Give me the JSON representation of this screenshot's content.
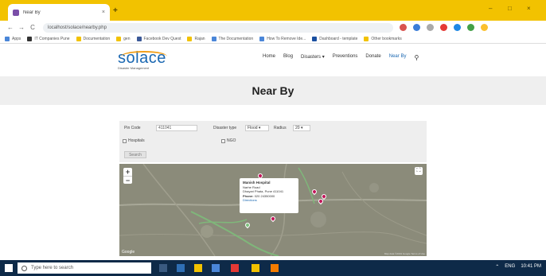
{
  "browser": {
    "tab_title": "Near By",
    "tab_close": "×",
    "new_tab": "+",
    "window_controls": [
      "–",
      "□",
      "×"
    ],
    "nav": {
      "back": "←",
      "forward": "→",
      "reload": "C"
    },
    "url": "localhost/solace/nearby.php",
    "bookmarks": [
      {
        "label": "Apps",
        "color": "#4a86d8"
      },
      {
        "label": "IT Companies Pune",
        "color": "#333333"
      },
      {
        "label": "Documentation",
        "color": "#f2c200"
      },
      {
        "label": "gen",
        "color": "#f2c200"
      },
      {
        "label": "Facebook Dev Quest",
        "color": "#3b5998"
      },
      {
        "label": "Rajan",
        "color": "#f2c200"
      },
      {
        "label": "The Documentation",
        "color": "#4a86d8"
      },
      {
        "label": "How To Remove Ide...",
        "color": "#4a86d8"
      },
      {
        "label": "Dashboard - template",
        "color": "#1a4fa0"
      },
      {
        "label": "Other bookmarks",
        "color": "#f2c200"
      }
    ]
  },
  "site": {
    "logo_text": "solace",
    "logo_tagline": "Disaster Management",
    "nav": [
      "Home",
      "Blog",
      "Disasters ▾",
      "Preventions",
      "Donate",
      "Near By"
    ],
    "active_nav": "Near By",
    "page_title": "Near By"
  },
  "filters": {
    "pincode_label": "Pin Code",
    "pincode_value": "411041",
    "disaster_label": "Disaster type",
    "disaster_value": "Flood ▾",
    "radius_label": "Radius",
    "radius_value": "20 ▾",
    "hospitals_label": "Hospitals",
    "ngos_label": "NGO",
    "search_button": "Search"
  },
  "map": {
    "zoom_in": "+",
    "zoom_out": "−",
    "fullscreen": "⛶",
    "popup": {
      "title": "Manish Hospital",
      "line1": "Narhe Road",
      "line2": "Dhayari Phata, Pune 411041",
      "phone_label": "Phone:",
      "phone": "020 24350000",
      "link": "Directions"
    },
    "logo": "Google",
    "attribution": "Map data ©2019 Google  Terms of Use"
  },
  "taskbar": {
    "search_placeholder": "Type here to search",
    "tray": [
      "⌃",
      "ENG",
      "10:41 PM"
    ]
  }
}
